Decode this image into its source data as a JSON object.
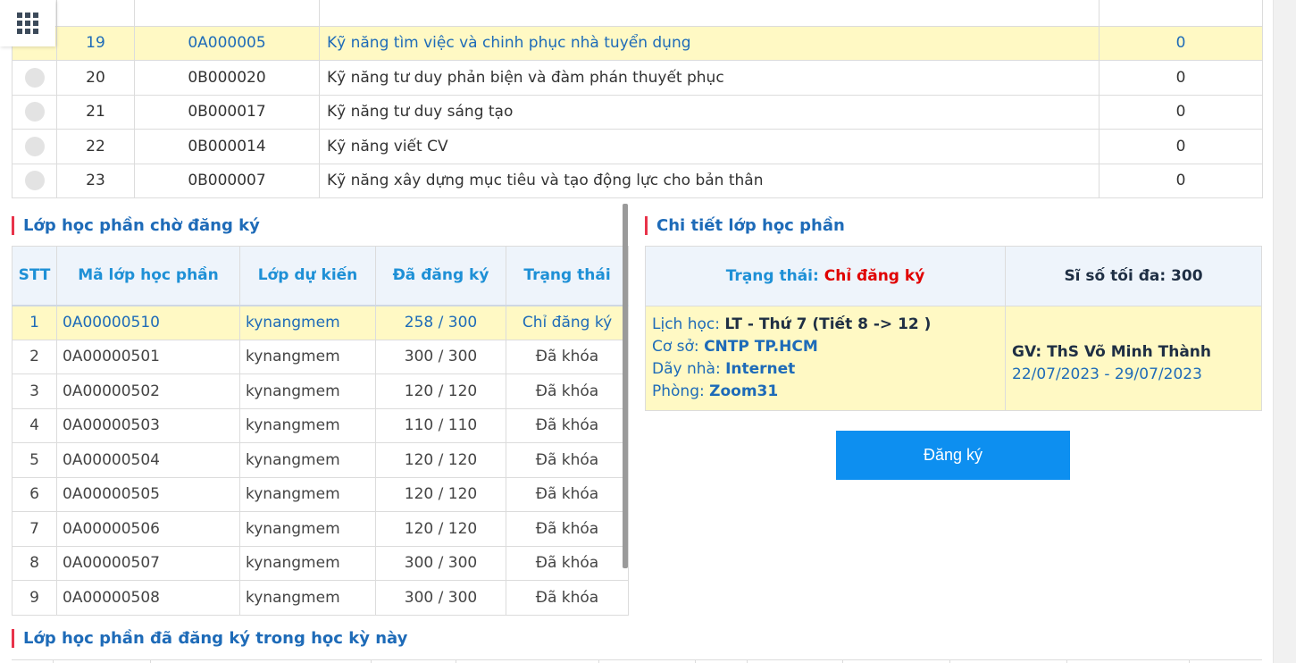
{
  "menu": {
    "icon": "grid-menu-icon"
  },
  "subjects": [
    {
      "num": "19",
      "code": "0A000005",
      "name": "Kỹ năng tìm việc và chinh phục nhà tuyển dụng",
      "count": "0",
      "selected": true
    },
    {
      "num": "20",
      "code": "0B000020",
      "name": "Kỹ năng tư duy phản biện và đàm phán thuyết phục",
      "count": "0",
      "selected": false
    },
    {
      "num": "21",
      "code": "0B000017",
      "name": "Kỹ năng tư duy sáng tạo",
      "count": "0",
      "selected": false
    },
    {
      "num": "22",
      "code": "0B000014",
      "name": "Kỹ năng viết CV",
      "count": "0",
      "selected": false
    },
    {
      "num": "23",
      "code": "0B000007",
      "name": "Kỹ năng xây dựng mục tiêu và tạo động lực cho bản thân",
      "count": "0",
      "selected": false
    }
  ],
  "pending": {
    "title": "Lớp học phần chờ đăng ký",
    "headers": {
      "stt": "STT",
      "code": "Mã lớp học phần",
      "class": "Lớp dự kiến",
      "registered": "Đã đăng ký",
      "status": "Trạng thái"
    },
    "rows": [
      {
        "stt": "1",
        "code": "0A00000510",
        "class": "kynangmem",
        "registered": "258 / 300",
        "status": "Chỉ đăng ký",
        "selected": true
      },
      {
        "stt": "2",
        "code": "0A00000501",
        "class": "kynangmem",
        "registered": "300 / 300",
        "status": "Đã khóa"
      },
      {
        "stt": "3",
        "code": "0A00000502",
        "class": "kynangmem",
        "registered": "120 / 120",
        "status": "Đã khóa"
      },
      {
        "stt": "4",
        "code": "0A00000503",
        "class": "kynangmem",
        "registered": "110 / 110",
        "status": "Đã khóa"
      },
      {
        "stt": "5",
        "code": "0A00000504",
        "class": "kynangmem",
        "registered": "120 / 120",
        "status": "Đã khóa"
      },
      {
        "stt": "6",
        "code": "0A00000505",
        "class": "kynangmem",
        "registered": "120 / 120",
        "status": "Đã khóa"
      },
      {
        "stt": "7",
        "code": "0A00000506",
        "class": "kynangmem",
        "registered": "120 / 120",
        "status": "Đã khóa"
      },
      {
        "stt": "8",
        "code": "0A00000507",
        "class": "kynangmem",
        "registered": "300 / 300",
        "status": "Đã khóa"
      },
      {
        "stt": "9",
        "code": "0A00000508",
        "class": "kynangmem",
        "registered": "300 / 300",
        "status": "Đã khóa"
      }
    ]
  },
  "detail": {
    "title": "Chi tiết lớp học phần",
    "status_label": "Trạng thái:",
    "status_value": "Chỉ đăng ký",
    "max_label": "Sĩ số tối đa: 300",
    "schedule_label": "Lịch học:",
    "schedule_value": "LT - Thứ 7 (Tiết 8 -> 12 )",
    "campus_label": "Cơ sở:",
    "campus_value": "CNTP TP.HCM",
    "building_label": "Dãy nhà:",
    "building_value": "Internet",
    "room_label": "Phòng:",
    "room_value": "Zoom31",
    "teacher": "GV: ThS Võ Minh Thành",
    "dates": "22/07/2023 - 29/07/2023",
    "register_label": "Đăng ký"
  },
  "registered": {
    "title": "Lớp học phần đã đăng ký trong học kỳ này"
  },
  "colors": {
    "accent": "#1e6bb8",
    "highlight": "#fff9c4",
    "button": "#0d8ff0",
    "status_red": "#e00000",
    "title_bar": "#e8334a"
  }
}
